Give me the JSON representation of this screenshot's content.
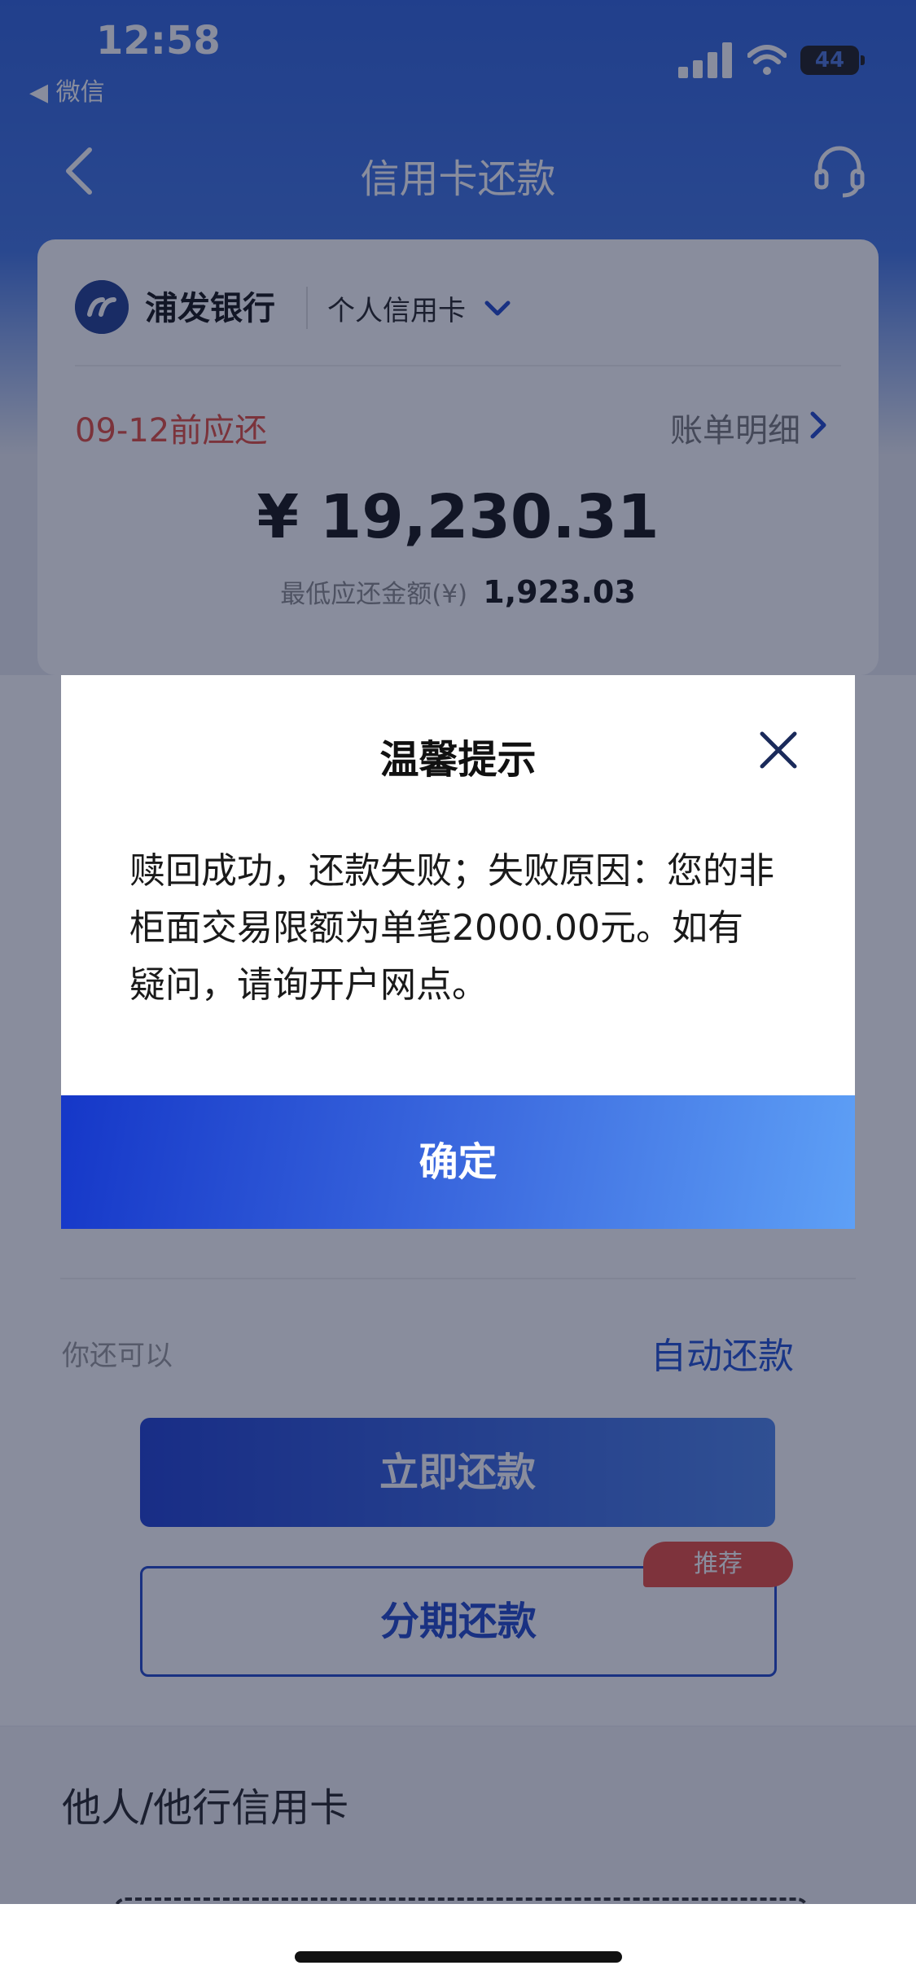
{
  "status_bar": {
    "time": "12:58",
    "back_app": "◀ 微信",
    "battery": "44"
  },
  "nav": {
    "title": "信用卡还款"
  },
  "card": {
    "bank_name": "浦发银行",
    "card_type": "个人信用卡",
    "due_date": "09-12前应还",
    "bill_detail": "账单明细",
    "amount": "¥ 19,230.31",
    "min_label": "最低应还金额(¥)",
    "min_value": "1,923.03"
  },
  "repay": {
    "also_can": "你还可以",
    "auto_repay": "自动还款",
    "repay_now": "立即还款",
    "installment": "分期还款",
    "recommend": "推荐"
  },
  "other": {
    "title": "他人/他行信用卡"
  },
  "dialog": {
    "title": "温馨提示",
    "message": "赎回成功，还款失败；失败原因：您的非柜面交易限额为单笔2000.00元。如有疑问，请询开户网点。",
    "confirm": "确定"
  },
  "colors": {
    "accent": "#1f46c8",
    "due": "#e24a3a",
    "badge": "#e94b3d"
  }
}
